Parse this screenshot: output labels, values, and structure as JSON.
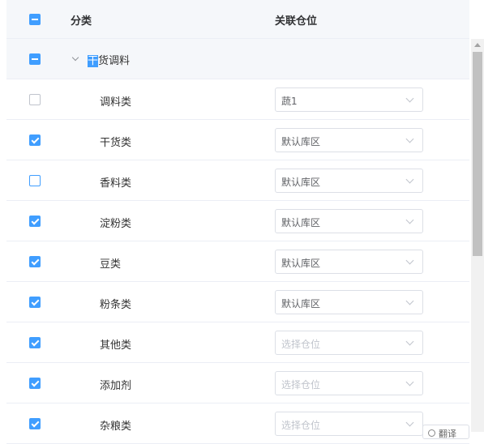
{
  "header": {
    "category": "分类",
    "location": "关联仓位"
  },
  "parent": {
    "first_char": "干",
    "rest": "货调料"
  },
  "rows": [
    {
      "label": "调料类",
      "select": "蔬1",
      "placeholder": false,
      "checked": "unchecked"
    },
    {
      "label": "干货类",
      "select": "默认库区",
      "placeholder": false,
      "checked": "checked"
    },
    {
      "label": "香料类",
      "select": "默认库区",
      "placeholder": false,
      "checked": "focus"
    },
    {
      "label": "淀粉类",
      "select": "默认库区",
      "placeholder": false,
      "checked": "checked"
    },
    {
      "label": "豆类",
      "select": "默认库区",
      "placeholder": false,
      "checked": "checked"
    },
    {
      "label": "粉条类",
      "select": "默认库区",
      "placeholder": false,
      "checked": "checked"
    },
    {
      "label": "其他类",
      "select": "选择仓位",
      "placeholder": true,
      "checked": "checked"
    },
    {
      "label": "添加剂",
      "select": "选择仓位",
      "placeholder": true,
      "checked": "checked"
    },
    {
      "label": "杂粮类",
      "select": "选择仓位",
      "placeholder": true,
      "checked": "checked"
    }
  ],
  "translate": {
    "label": "翻译"
  },
  "colors": {
    "primary": "#409eff",
    "header_bg": "#f5f7fa",
    "border": "#ebeef5"
  }
}
